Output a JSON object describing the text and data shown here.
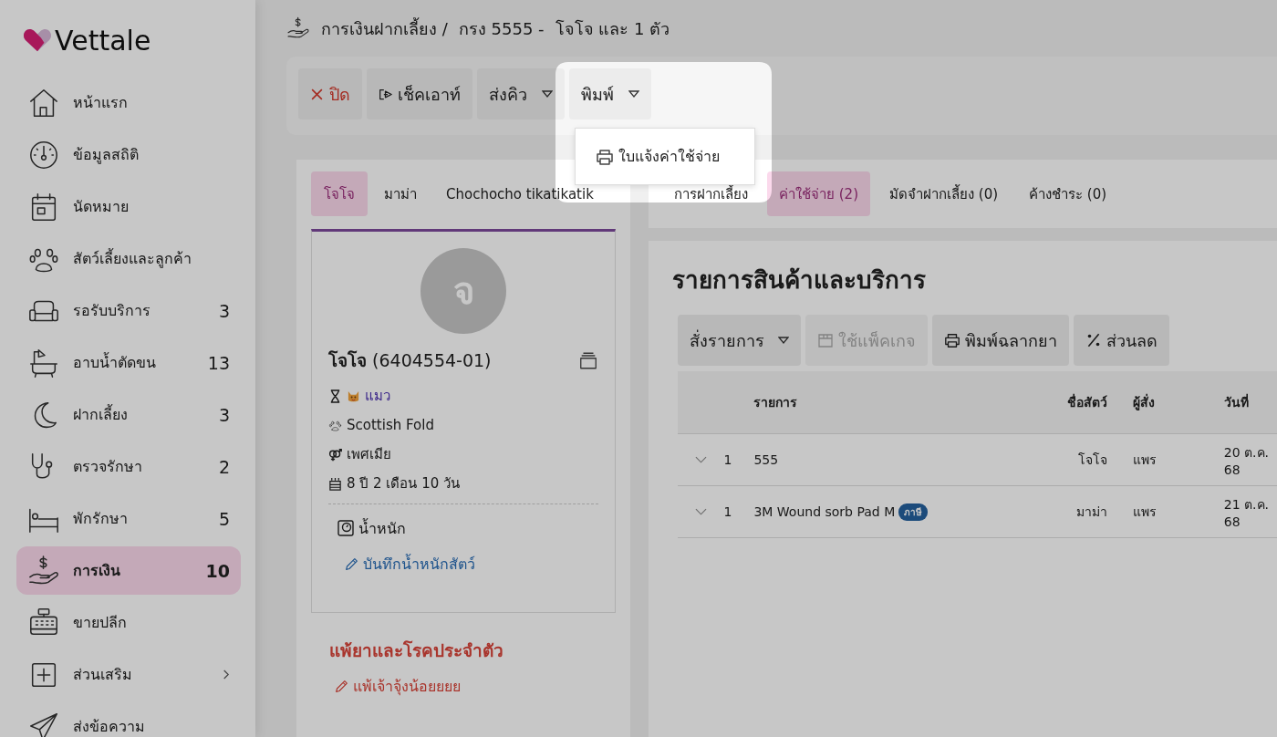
{
  "app": {
    "name": "Vettale"
  },
  "sidebar": {
    "items": [
      {
        "label": "หน้าแรก",
        "selected": false,
        "has_submenu": false
      },
      {
        "label": "ข้อมูลสถิติ",
        "selected": false,
        "has_submenu": false
      },
      {
        "label": "นัดหมาย",
        "selected": false,
        "has_submenu": false
      },
      {
        "label": "สัตว์เลี้ยงและลูกค้า",
        "selected": false,
        "has_submenu": false
      },
      {
        "label": "รอรับบริการ",
        "count": "3",
        "selected": false,
        "has_submenu": false
      },
      {
        "label": "อาบน้ำตัดขน",
        "count": "13",
        "selected": false,
        "has_submenu": false
      },
      {
        "label": "ฝากเลี้ยง",
        "count": "3",
        "selected": false,
        "has_submenu": false
      },
      {
        "label": "ตรวจรักษา",
        "count": "2",
        "selected": false,
        "has_submenu": false
      },
      {
        "label": "พักรักษา",
        "count": "5",
        "selected": false,
        "has_submenu": false
      },
      {
        "label": "การเงิน",
        "count": "10",
        "selected": true,
        "has_submenu": false
      },
      {
        "label": "ขายปลีก",
        "selected": false,
        "has_submenu": false
      },
      {
        "label": "ส่วนเสริม",
        "selected": false,
        "has_submenu": true
      },
      {
        "label": "ส่งข้อความ",
        "selected": false,
        "has_submenu": false
      }
    ]
  },
  "breadcrumb": [
    "การเงินฝากเลี้ยง /",
    "กรง 5555 -",
    "โจโจ และ 1 ตัว"
  ],
  "toolbar": {
    "buttons": [
      {
        "label": "ปิด",
        "kind": "close"
      },
      {
        "label": "เช็คเอาท์",
        "kind": "checkout"
      },
      {
        "label": "ส่งคิว",
        "kind": "dropdown"
      },
      {
        "label": "พิมพ์",
        "kind": "dropdown"
      }
    ]
  },
  "print_menu": {
    "items": [
      "ใบแจ้งค่าใช้จ่าย"
    ]
  },
  "pet_tabs": [
    {
      "label": "โจโจ",
      "selected": true
    },
    {
      "label": "มาม่า",
      "selected": false
    },
    {
      "label": "Chochocho tikatikatik",
      "selected": false
    }
  ],
  "pet": {
    "avatar_initial": "จ",
    "name": "โจโจ",
    "code": "(6404554-01)",
    "species": "แมว",
    "breed": "Scottish Fold",
    "sex": "เพศเมีย",
    "age": "8 ปี 2 เดือน 10 วัน",
    "weight_label": "น้ำหนัก",
    "weight_link": "บันทึกน้ำหนักสัตว์"
  },
  "allergy": {
    "title": "แพ้ยาและโรคประจำตัว",
    "item": "แพ้เจ้าจุ้งน้อยยยย"
  },
  "detail_tabs": [
    {
      "label": "การฝากเลี้ยง",
      "selected": false
    },
    {
      "label": "ค่าใช้จ่าย (2)",
      "selected": true
    },
    {
      "label": "มัดจำฝากเลี้ยง (0)",
      "selected": false
    },
    {
      "label": "ค้างชำระ (0)",
      "selected": false
    }
  ],
  "items_section": {
    "title": "รายการสินค้าและบริการ",
    "actions": [
      {
        "label": "สั่งรายการ",
        "kind": "dropdown",
        "disabled": false
      },
      {
        "label": "ใช้แพ็คเกจ",
        "kind": "package",
        "disabled": true
      },
      {
        "label": "พิมพ์ฉลากยา",
        "kind": "print",
        "disabled": false
      },
      {
        "label": "ส่วนลด",
        "kind": "discount",
        "disabled": false
      }
    ],
    "columns": [
      "รายการ",
      "ชื่อสัตว์",
      "ผู้สั่ง",
      "วันที่"
    ],
    "rows": [
      {
        "qty": "1",
        "item": "555",
        "pet": "โจโจ",
        "orderer": "แพร",
        "date": "20 ต.ค. 68"
      },
      {
        "qty": "1",
        "item": "3M Wound sorb Pad M",
        "badge": "ภาษี",
        "pet": "มาม่า",
        "orderer": "แพร",
        "date": "21 ต.ค. 68"
      }
    ]
  }
}
